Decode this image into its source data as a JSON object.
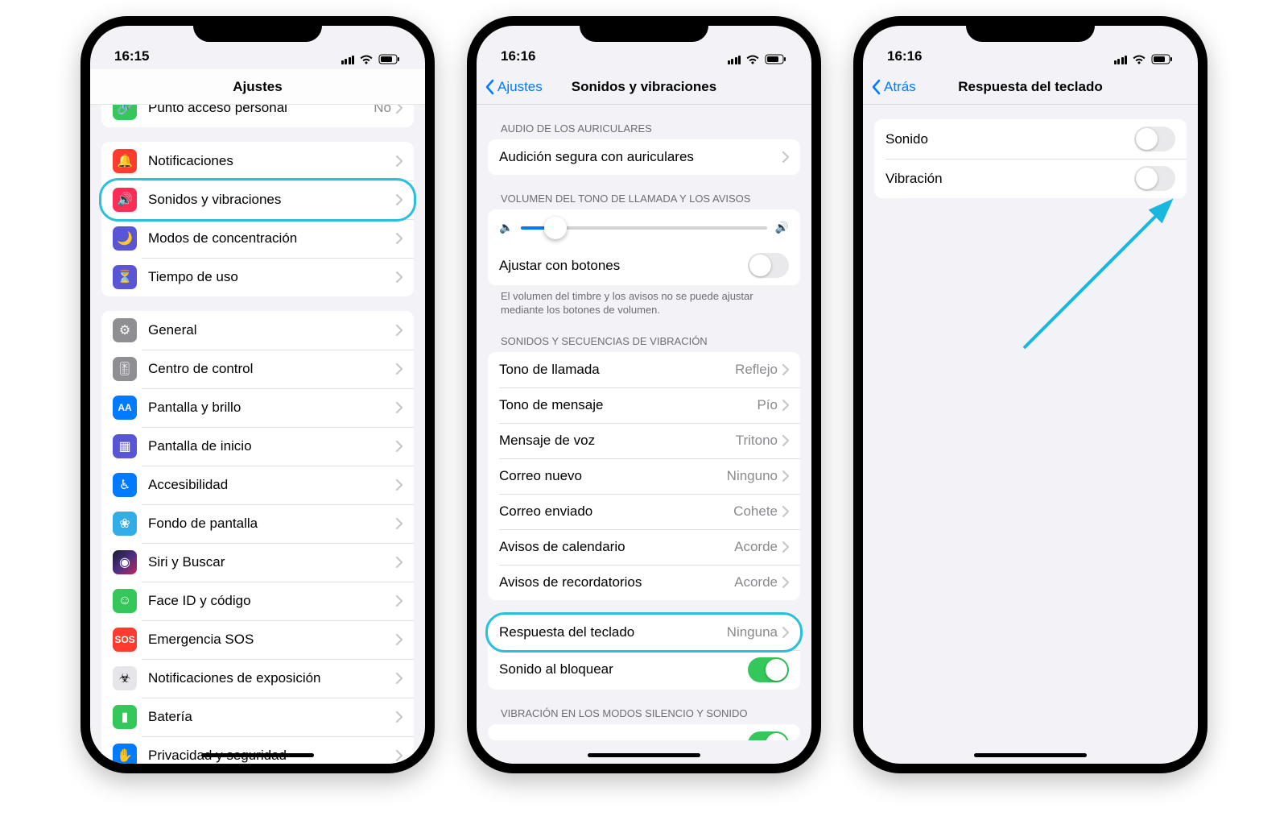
{
  "phone1": {
    "time": "16:15",
    "nav_title": "Ajustes",
    "groups": [
      {
        "items": [
          {
            "icon": "link-icon",
            "bg": "bg-green",
            "label": "Punto acceso personal",
            "value": "No"
          }
        ]
      },
      {
        "items": [
          {
            "icon": "bell-icon",
            "bg": "bg-red",
            "label": "Notificaciones"
          },
          {
            "icon": "speaker-icon",
            "bg": "bg-pink",
            "label": "Sonidos y vibraciones",
            "highlight": true
          },
          {
            "icon": "moon-icon",
            "bg": "bg-indigo",
            "label": "Modos de concentración"
          },
          {
            "icon": "hourglass-icon",
            "bg": "bg-indigo",
            "label": "Tiempo de uso"
          }
        ]
      },
      {
        "items": [
          {
            "icon": "gear-icon",
            "bg": "bg-gray",
            "label": "General"
          },
          {
            "icon": "switches-icon",
            "bg": "bg-gray",
            "label": "Centro de control"
          },
          {
            "icon": "aa-icon",
            "bg": "bg-blue",
            "label": "Pantalla y brillo"
          },
          {
            "icon": "grid-icon",
            "bg": "bg-indigo",
            "label": "Pantalla de inicio"
          },
          {
            "icon": "person-icon",
            "bg": "bg-blue",
            "label": "Accesibilidad"
          },
          {
            "icon": "flower-icon",
            "bg": "bg-cyan",
            "label": "Fondo de pantalla"
          },
          {
            "icon": "siri-icon",
            "bg": "bg-siri",
            "label": "Siri y Buscar"
          },
          {
            "icon": "faceid-icon",
            "bg": "bg-green",
            "label": "Face ID y código"
          },
          {
            "icon": "sos-icon",
            "bg": "bg-sos",
            "label": "Emergencia SOS"
          },
          {
            "icon": "virus-icon",
            "bg": "bg-white",
            "label": "Notificaciones de exposición"
          },
          {
            "icon": "battery-icon",
            "bg": "bg-green",
            "label": "Batería"
          },
          {
            "icon": "hand-icon",
            "bg": "bg-blue",
            "label": "Privacidad y seguridad"
          }
        ]
      }
    ]
  },
  "phone2": {
    "time": "16:16",
    "back": "Ajustes",
    "nav_title": "Sonidos y vibraciones",
    "section_audio_header": "AUDIO DE LOS AURICULARES",
    "audio_item": "Audición segura con auriculares",
    "section_volume_header": "VOLUMEN DEL TONO DE LLAMADA Y LOS AVISOS",
    "adjust_buttons": "Ajustar con botones",
    "volume_footer": "El volumen del timbre y los avisos no se puede ajustar mediante los botones de volumen.",
    "section_sounds_header": "SONIDOS Y SECUENCIAS DE VIBRACIÓN",
    "sounds": [
      {
        "label": "Tono de llamada",
        "value": "Reflejo"
      },
      {
        "label": "Tono de mensaje",
        "value": "Pío"
      },
      {
        "label": "Mensaje de voz",
        "value": "Tritono"
      },
      {
        "label": "Correo nuevo",
        "value": "Ninguno"
      },
      {
        "label": "Correo enviado",
        "value": "Cohete"
      },
      {
        "label": "Avisos de calendario",
        "value": "Acorde"
      },
      {
        "label": "Avisos de recordatorios",
        "value": "Acorde"
      }
    ],
    "keyboard_response": {
      "label": "Respuesta del teclado",
      "value": "Ninguna"
    },
    "lock_sound": "Sonido al bloquear",
    "section_vibration_header": "VIBRACIÓN EN LOS MODOS SILENCIO Y SONIDO"
  },
  "phone3": {
    "time": "16:16",
    "back": "Atrás",
    "nav_title": "Respuesta del teclado",
    "items": [
      {
        "label": "Sonido",
        "on": false
      },
      {
        "label": "Vibración",
        "on": false
      }
    ]
  }
}
